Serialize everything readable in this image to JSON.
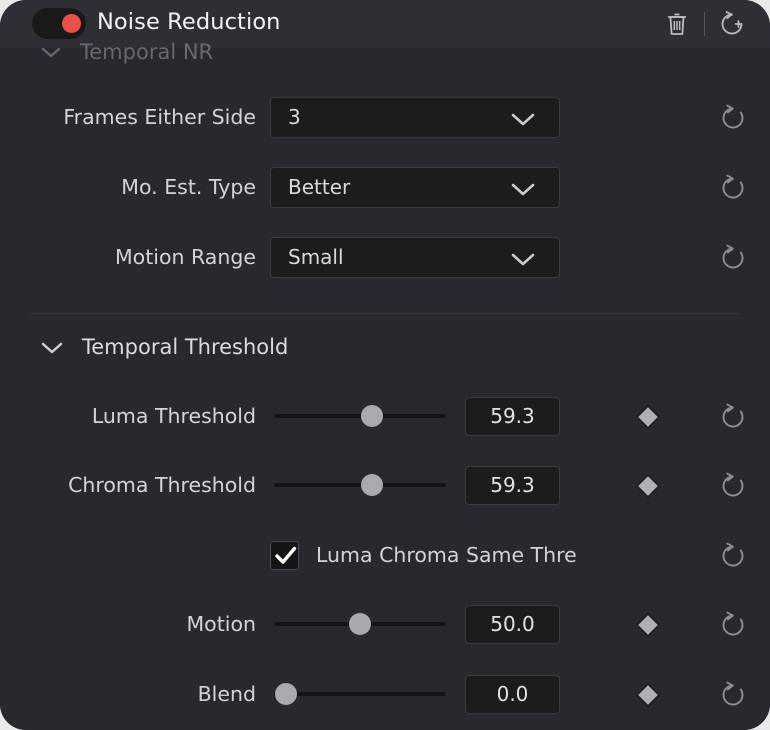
{
  "header": {
    "title": "Noise Reduction",
    "power_toggle": {
      "name": "node-enable-toggle",
      "state": "on",
      "color": "#e8514a"
    },
    "trash_icon": "trash-icon",
    "reset_all_icon": "reset-add-keyframe-icon"
  },
  "clipped_section": {
    "label": "Temporal NR",
    "chevron": "chevron-down-icon"
  },
  "dropdown_rows": [
    {
      "label": "Frames Either Side",
      "value": "3",
      "reset_icon": "reset-icon"
    },
    {
      "label": "Mo. Est. Type",
      "value": "Better",
      "reset_icon": "reset-icon"
    },
    {
      "label": "Motion Range",
      "value": "Small",
      "reset_icon": "reset-icon"
    }
  ],
  "section": {
    "label": "Temporal Threshold",
    "chevron": "chevron-down-icon"
  },
  "slider_rows": [
    {
      "label": "Luma Threshold",
      "value": "59.3",
      "percent": 57,
      "keyframe_icon": "keyframe-diamond-icon",
      "reset_icon": "reset-icon"
    },
    {
      "label": "Chroma Threshold",
      "value": "59.3",
      "percent": 57,
      "keyframe_icon": "keyframe-diamond-icon",
      "reset_icon": "reset-icon"
    },
    {
      "label": "Motion",
      "value": "50.0",
      "percent": 50,
      "keyframe_icon": "keyframe-diamond-icon",
      "reset_icon": "reset-icon"
    },
    {
      "label": "Blend",
      "value": "0.0",
      "percent": 7,
      "keyframe_icon": "keyframe-diamond-icon",
      "reset_icon": "reset-icon"
    }
  ],
  "checkbox_row": {
    "label": "Luma Chroma Same Thre",
    "checked": true,
    "check_icon": "checkmark-icon",
    "reset_icon": "reset-icon"
  },
  "colors": {
    "panel_bg": "#28282e",
    "header_bg": "#2e2e35",
    "field_bg": "#1c1c1f",
    "accent_red": "#e8514a",
    "text": "#d4d4d8",
    "thumb": "#a9a9ae"
  }
}
